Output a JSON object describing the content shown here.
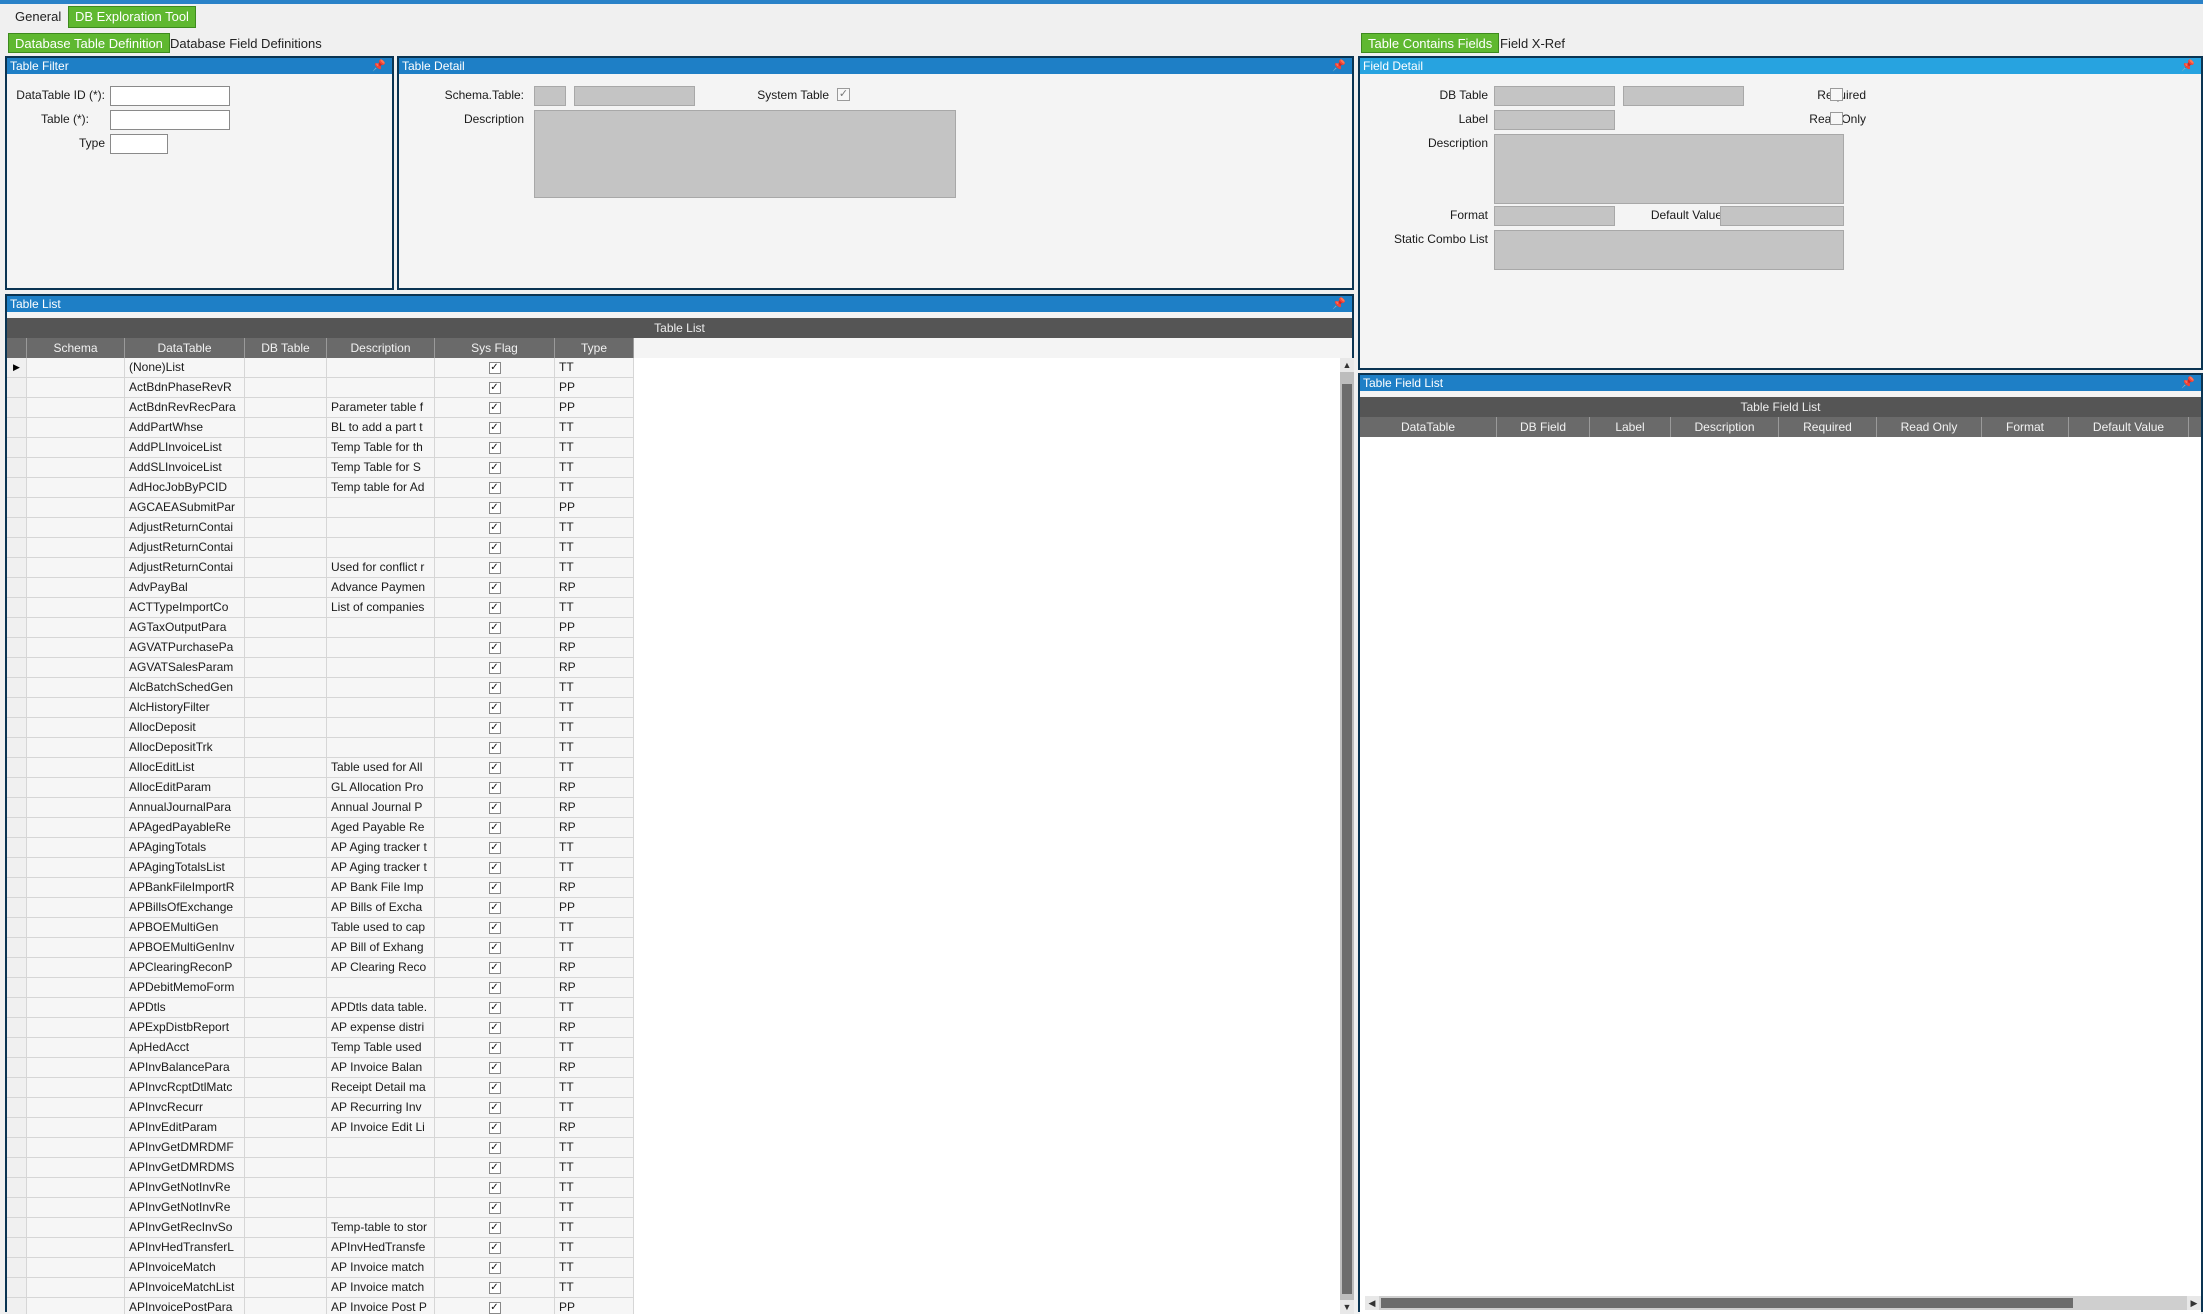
{
  "top_tabs": [
    "General",
    "DB Exploration Tool"
  ],
  "left_tabs": [
    "Database Table Definition",
    "Database Field Definitions"
  ],
  "right_tabs": [
    "Table Contains Fields",
    "Field X-Ref"
  ],
  "pin_glyph": "📌",
  "table_filter": {
    "title": "Table Filter",
    "datatable_id_label": "DataTable ID (*):",
    "table_label": "Table (*):",
    "type_label": "Type",
    "datatable_id_value": "",
    "table_value": "",
    "type_value": ""
  },
  "table_detail": {
    "title": "Table Detail",
    "schema_table_label": "Schema.Table:",
    "system_table_label": "System Table",
    "description_label": "Description"
  },
  "field_detail": {
    "title": "Field Detail",
    "db_table_label": "DB Table",
    "required_label": "Required",
    "label_label": "Label",
    "read_only_label": "Read Only",
    "description_label": "Description",
    "format_label": "Format",
    "default_value_label": "Default Value",
    "static_combo_label": "Static Combo List"
  },
  "table_list": {
    "panel_title": "Table List",
    "grid_title": "Table List",
    "columns": [
      "Schema",
      "DataTable",
      "DB Table",
      "Description",
      "Sys Flag",
      "Type"
    ],
    "rows": [
      [
        "(None)List",
        "",
        "TT"
      ],
      [
        "ActBdnPhaseRevR",
        "",
        "PP"
      ],
      [
        "ActBdnRevRecPara",
        "Parameter table f",
        "PP"
      ],
      [
        "AddPartWhse",
        "BL to add a part t",
        "TT"
      ],
      [
        "AddPLInvoiceList",
        "Temp Table for th",
        "TT"
      ],
      [
        "AddSLInvoiceList",
        "Temp Table for S",
        "TT"
      ],
      [
        "AdHocJobByPCID",
        "Temp table for Ad",
        "TT"
      ],
      [
        "AGCAEASubmitPar",
        "",
        "PP"
      ],
      [
        "AdjustReturnContai",
        "",
        "TT"
      ],
      [
        "AdjustReturnContai",
        "",
        "TT"
      ],
      [
        "AdjustReturnContai",
        "Used for conflict r",
        "TT"
      ],
      [
        "AdvPayBal",
        "Advance Paymen",
        "RP"
      ],
      [
        "ACTTypeImportCo",
        "List of companies",
        "TT"
      ],
      [
        "AGTaxOutputPara",
        "",
        "PP"
      ],
      [
        "AGVATPurchasePa",
        "",
        "RP"
      ],
      [
        "AGVATSalesParam",
        "",
        "RP"
      ],
      [
        "AlcBatchSchedGen",
        "",
        "TT"
      ],
      [
        "AlcHistoryFilter",
        "",
        "TT"
      ],
      [
        "AllocDeposit",
        "",
        "TT"
      ],
      [
        "AllocDepositTrk",
        "",
        "TT"
      ],
      [
        "AllocEditList",
        "Table used for All",
        "TT"
      ],
      [
        "AllocEditParam",
        "GL Allocation Pro",
        "RP"
      ],
      [
        "AnnualJournalPara",
        "Annual Journal P",
        "RP"
      ],
      [
        "APAgedPayableRe",
        "Aged Payable Re",
        "RP"
      ],
      [
        "APAgingTotals",
        "AP Aging tracker t",
        "TT"
      ],
      [
        "APAgingTotalsList",
        "AP Aging tracker t",
        "TT"
      ],
      [
        "APBankFileImportR",
        "AP Bank File Imp",
        "RP"
      ],
      [
        "APBillsOfExchange",
        "AP Bills of Excha",
        "PP"
      ],
      [
        "APBOEMultiGen",
        "Table used to cap",
        "TT"
      ],
      [
        "APBOEMultiGenInv",
        "AP Bill of Exhang",
        "TT"
      ],
      [
        "APClearingReconP",
        "AP Clearing Reco",
        "RP"
      ],
      [
        "APDebitMemoForm",
        "",
        "RP"
      ],
      [
        "APDtls",
        "APDtls data table.",
        "TT"
      ],
      [
        "APExpDistbReport",
        "AP expense distri",
        "RP"
      ],
      [
        "ApHedAcct",
        "Temp Table used",
        "TT"
      ],
      [
        "APInvBalancePara",
        "AP Invoice Balan",
        "RP"
      ],
      [
        "APInvcRcptDtlMatc",
        "Receipt Detail ma",
        "TT"
      ],
      [
        "APInvcRecurr",
        "AP Recurring Inv",
        "TT"
      ],
      [
        "APInvEditParam",
        "AP Invoice Edit Li",
        "RP"
      ],
      [
        "APInvGetDMRDMF",
        "",
        "TT"
      ],
      [
        "APInvGetDMRDMS",
        "",
        "TT"
      ],
      [
        "APInvGetNotInvRe",
        "",
        "TT"
      ],
      [
        "APInvGetNotInvRe",
        "",
        "TT"
      ],
      [
        "APInvGetRecInvSo",
        "Temp-table to stor",
        "TT"
      ],
      [
        "APInvHedTransferL",
        "APInvHedTransfe",
        "TT"
      ],
      [
        "APInvoiceMatch",
        "AP Invoice match",
        "TT"
      ],
      [
        "APInvoiceMatchList",
        "AP Invoice match",
        "TT"
      ],
      [
        "APInvoicePostPara",
        "AP Invoice Post P",
        "PP"
      ]
    ]
  },
  "table_field_list": {
    "panel_title": "Table Field List",
    "grid_title": "Table Field List",
    "columns": [
      "DataTable",
      "DB Field",
      "Label",
      "Description",
      "Required",
      "Read Only",
      "Format",
      "Default Value"
    ]
  },
  "colors": {
    "accent_green": "#5fb830",
    "header_blue": "#1e7fc6",
    "field_detail_blue": "#27a3e0"
  }
}
